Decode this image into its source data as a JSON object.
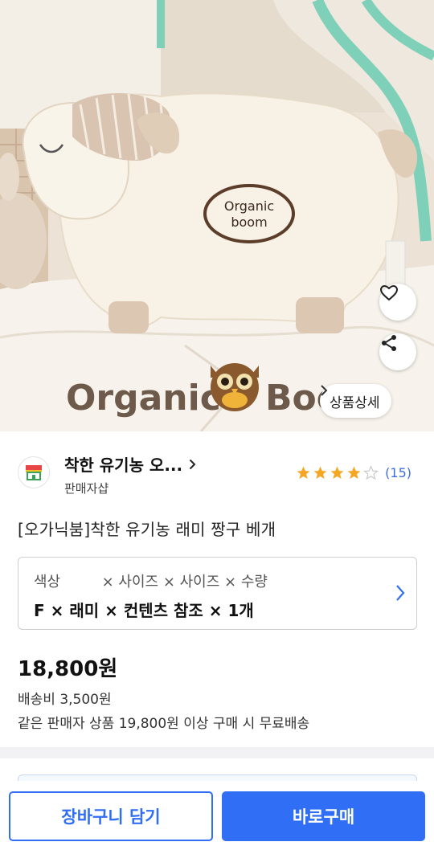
{
  "hero": {
    "pillow_emblem_line1": "Organic",
    "pillow_emblem_line2": "boom",
    "brand_watermark_left": "Organic",
    "brand_watermark_right": "Boo",
    "detail_label": "상품상세"
  },
  "seller": {
    "name": "착한 유기농 오...",
    "type": "판매자샵",
    "rating_stars": 4,
    "rating_max": 5,
    "review_count": "(15)"
  },
  "product": {
    "title": "[오가닉붐]착한 유기농 래미 짱구 베개"
  },
  "options": {
    "labels": "색상         × 사이즈 × 사이즈 × 수량",
    "values": "F × 래미 × 컨텐츠 참조 × 1개"
  },
  "pricing": {
    "price": "18,800원",
    "shipping": "배송비 3,500원",
    "free_shipping": "같은 판매자 상품 19,800원 이상 구매 시 무료배송"
  },
  "actions": {
    "cart": "장바구니 담기",
    "buy": "바로구매"
  },
  "colors": {
    "accent": "#2f6ef5",
    "star": "#f5a623",
    "review": "#3b6fe6"
  },
  "icons": {
    "favorite": "heart-icon",
    "share": "share-icon",
    "detail": "chevron-right-icon",
    "seller": "store-icon",
    "option": "chevron-right-icon"
  }
}
